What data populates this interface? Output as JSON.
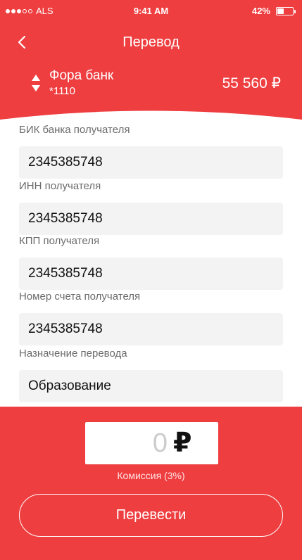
{
  "status_bar": {
    "carrier": "ALS",
    "time": "9:41 AM",
    "battery_percent": "42%",
    "battery_level": 0.42
  },
  "nav": {
    "title": "Перевод",
    "back_icon": "chevron-left-icon"
  },
  "account": {
    "bank_name": "Фора банк",
    "account_number": "*1110",
    "balance": "55 560 ₽",
    "selector_icon": "sort-arrows-icon"
  },
  "form": {
    "fields": [
      {
        "label": "БИК банка получателя",
        "value": "2345385748"
      },
      {
        "label": "ИНН получателя",
        "value": "2345385748"
      },
      {
        "label": "КПП получателя",
        "value": "2345385748"
      },
      {
        "label": "Номер счета получателя",
        "value": "2345385748"
      },
      {
        "label": "Назначение перевода",
        "value": "Образование"
      }
    ]
  },
  "amount": {
    "value": "0",
    "currency": "₽",
    "commission": "Комиссия (3%)"
  },
  "submit": {
    "label": "Перевести"
  },
  "colors": {
    "accent": "#ee3e40",
    "field_bg": "#f3f3f3",
    "label_text": "#6b6b6b"
  }
}
